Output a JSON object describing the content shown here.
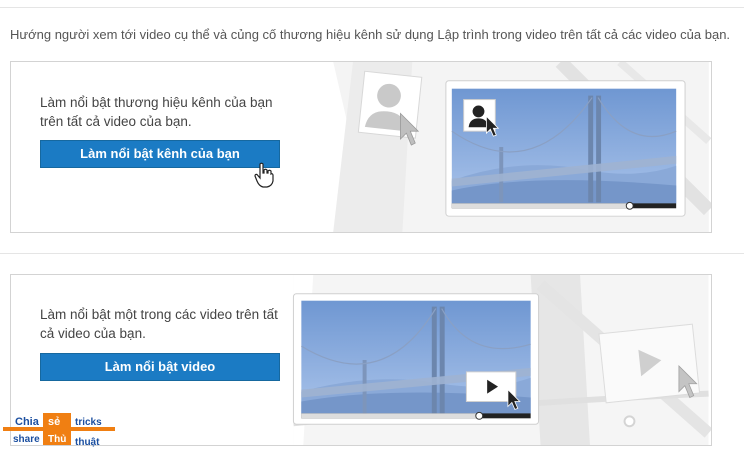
{
  "intro_text": "Hướng người xem tới video cụ thể và củng cố thương hiệu kênh sử dụng Lập trình trong video trên tất cả các video của bạn.",
  "channel_card": {
    "description": "Làm nổi bật thương hiệu kênh của bạn trên tất cả video của bạn.",
    "button_label": "Làm nổi bật kênh của bạn"
  },
  "video_card": {
    "description": "Làm nổi bật một trong các video trên tất cả video của bạn.",
    "button_label": "Làm nổi bật video"
  },
  "watermark": {
    "line1_left": "Chia",
    "line1_mid": "sẻ",
    "line1_right": "tricks",
    "line2_left": "share",
    "line2_mid": "Thủ",
    "line2_right": "thuật"
  },
  "colors": {
    "button_blue": "#1b7bc4",
    "video_sky": "#7fa3d6",
    "watermark_orange": "#f07f12"
  },
  "icons": [
    "hand-cursor-icon",
    "mouse-pointer-icon",
    "avatar-icon",
    "play-icon",
    "bridge-illustration"
  ]
}
